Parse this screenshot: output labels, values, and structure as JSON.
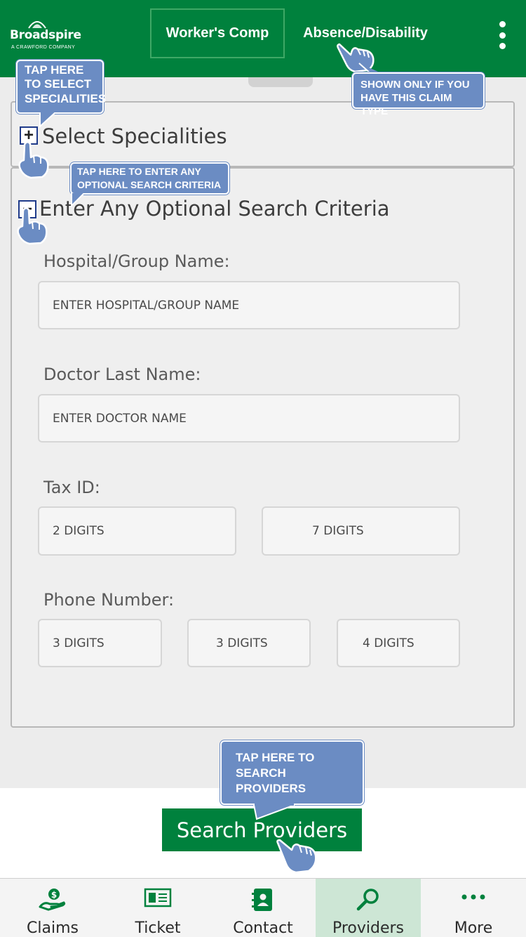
{
  "header": {
    "logo_name": "Broadspire",
    "logo_sub": "A CRAWFORD COMPANY",
    "tabs": [
      {
        "label": "Worker's Comp",
        "active": true
      },
      {
        "label": "Absence/Disability",
        "active": false
      }
    ],
    "menu_icon": "more-vertical-icon"
  },
  "sections": {
    "specialities": {
      "toggle": "+",
      "title": "Select Specialities",
      "icon": "expand-icon"
    },
    "optional": {
      "toggle": "−",
      "title": "Enter Any Optional Search Criteria",
      "icon": "collapse-icon"
    }
  },
  "form": {
    "hospital": {
      "label": "Hospital/Group Name:",
      "placeholder": "ENTER HOSPITAL/GROUP NAME"
    },
    "doctor": {
      "label": "Doctor Last Name:",
      "placeholder": "ENTER DOCTOR NAME"
    },
    "tax": {
      "label": "Tax ID:",
      "part1": "2 DIGITS",
      "part2": "7 DIGITS"
    },
    "phone": {
      "label": "Phone Number:",
      "part1": "3 DIGITS",
      "part2": "3 DIGITS",
      "part3": "4 DIGITS"
    }
  },
  "search_button": {
    "label": "Search Providers"
  },
  "bottom_nav": [
    {
      "label": "Claims",
      "icon": "dollar-hand-icon",
      "active": false
    },
    {
      "label": "Ticket",
      "icon": "ticket-icon",
      "active": false
    },
    {
      "label": "Contact",
      "icon": "contact-book-icon",
      "active": false
    },
    {
      "label": "Providers",
      "icon": "search-icon",
      "active": true
    },
    {
      "label": "More",
      "icon": "more-dots-icon",
      "active": false
    }
  ],
  "callouts": {
    "tab_note": "SHOWN ONLY IF YOU\nHAVE THIS CLAIM TYPE",
    "specialities": "TAP HERE\nTO SELECT\nSPECIALITIES",
    "optional": "TAP HERE TO ENTER ANY\nOPTIONAL SEARCH CRITERIA",
    "search": "TAP HERE TO\nSEARCH PROVIDERS"
  },
  "colors": {
    "brand_green": "#00813d",
    "callout_blue": "#6b8cc3",
    "active_nav": "#cde6d5"
  }
}
